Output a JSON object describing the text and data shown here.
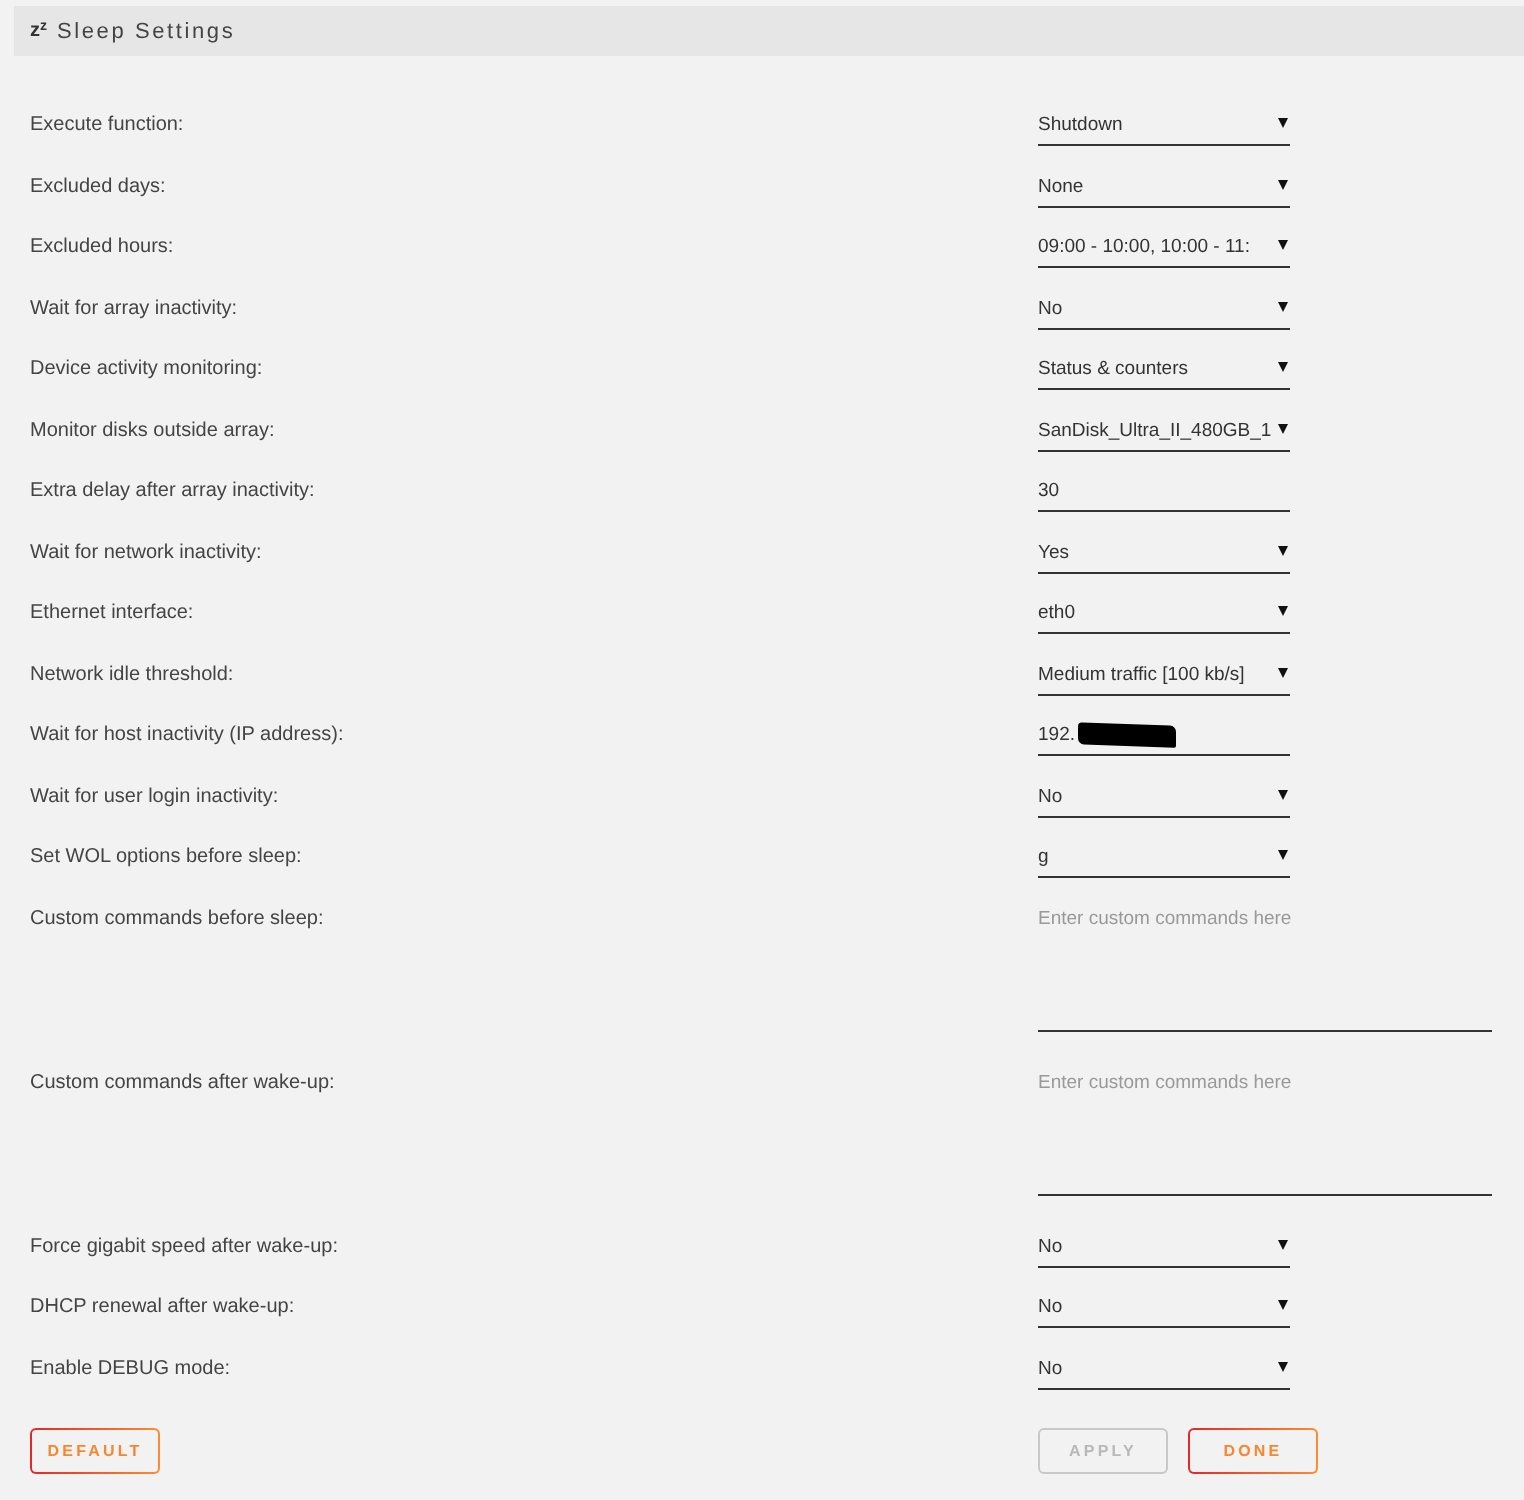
{
  "header": {
    "icon": "z$^{z}$",
    "title": "Sleep Settings"
  },
  "settings": [
    {
      "label": "Execute function:",
      "kind": "select",
      "value": "Shutdown"
    },
    {
      "label": "Excluded days:",
      "kind": "select",
      "value": "None"
    },
    {
      "label": "Excluded hours:",
      "kind": "select",
      "value": "09:00 - 10:00, 10:00 - 11:"
    },
    {
      "label": "Wait for array inactivity:",
      "kind": "select",
      "value": "No"
    },
    {
      "label": "Device activity monitoring:",
      "kind": "select",
      "value": "Status & counters"
    },
    {
      "label": "Monitor disks outside array:",
      "kind": "select",
      "value": "SanDisk_Ultra_II_480GB_1"
    },
    {
      "label": "Extra delay after array inactivity:",
      "kind": "input",
      "value": "30"
    },
    {
      "label": "Wait for network inactivity:",
      "kind": "select",
      "value": "Yes"
    },
    {
      "label": "Ethernet interface:",
      "kind": "select",
      "value": "eth0"
    },
    {
      "label": "Network idle threshold:",
      "kind": "select",
      "value": "Medium traffic [100 kb/s]"
    },
    {
      "label": "Wait for host inactivity (IP address):",
      "kind": "input",
      "value": "192.",
      "redacted": true
    },
    {
      "label": "Wait for user login inactivity:",
      "kind": "select",
      "value": "No"
    },
    {
      "label": "Set WOL options before sleep:",
      "kind": "select",
      "value": "g"
    },
    {
      "label": "Custom commands before sleep:",
      "kind": "textarea",
      "placeholder": "Enter custom commands here"
    },
    {
      "label": "Custom commands after wake-up:",
      "kind": "textarea",
      "placeholder": "Enter custom commands here"
    },
    {
      "label": "Force gigabit speed after wake-up:",
      "kind": "select",
      "value": "No"
    },
    {
      "label": "DHCP renewal after wake-up:",
      "kind": "select",
      "value": "No"
    },
    {
      "label": "Enable DEBUG mode:",
      "kind": "select",
      "value": "No"
    }
  ],
  "footer": {
    "left": [
      {
        "label": "DEFAULT",
        "disabled": false
      }
    ],
    "right": [
      {
        "label": "APPLY",
        "disabled": true
      },
      {
        "label": "DONE",
        "disabled": false
      }
    ]
  }
}
